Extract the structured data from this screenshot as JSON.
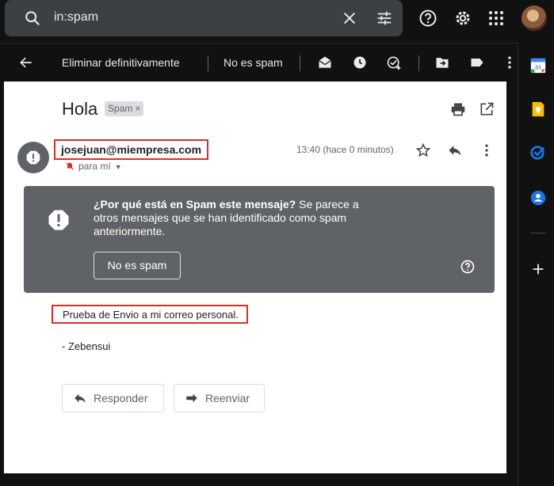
{
  "search": {
    "query": "in:spam",
    "icon": "search-icon",
    "clear_icon": "close-icon",
    "options_icon": "tune-icon"
  },
  "header_icons": [
    "help-icon",
    "settings-icon",
    "apps-icon",
    "avatar"
  ],
  "toolbar": {
    "back_icon": "arrow-back-icon",
    "delete_forever": "Eliminar definitivamente",
    "not_spam": "No es spam",
    "icons": [
      "mark-read-icon",
      "snooze-icon",
      "add-task-icon",
      "move-to-icon",
      "label-icon",
      "more-vert-icon"
    ]
  },
  "side_rail": {
    "items": [
      "calendar-icon",
      "keep-icon",
      "tasks-icon",
      "contacts-icon",
      "add-icon"
    ],
    "colors": {
      "calendar": "#4285f4",
      "keep": "#fbbc04",
      "tasks": "#1a73e8",
      "contacts": "#1a73e8"
    }
  },
  "message": {
    "subject": "Hola",
    "label": "Spam",
    "label_remove": "×",
    "sender": "josejuan@miempresa.com",
    "to": "para mí",
    "time": "13:40 (hace 0 minutos)",
    "warning": {
      "title": "¿Por qué está en Spam este mensaje?",
      "text": " Se parece a otros mensajes que se han identificado como spam anteriormente.",
      "button": "No es spam"
    },
    "body_line": "Prueba de Envio a mi correo personal.",
    "signature": "- Zebensui",
    "reply": "Responder",
    "forward": "Reenviar"
  },
  "colors": {
    "dark_bg": "#111111",
    "search_bg": "#3c4043",
    "warning_bg": "#5f6368",
    "highlight": "#d93025"
  }
}
